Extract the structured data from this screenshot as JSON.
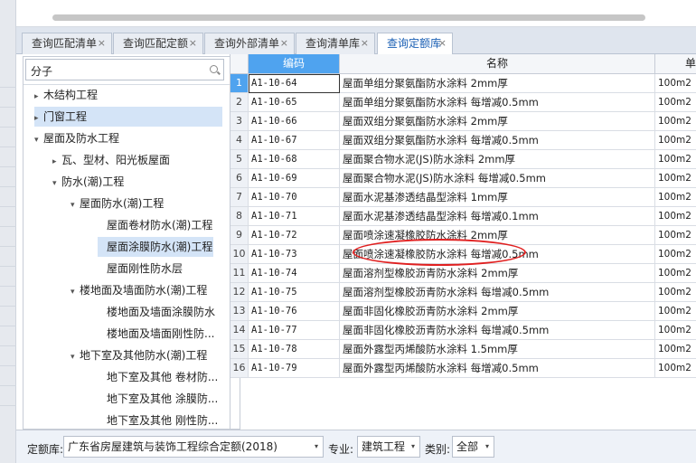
{
  "tabs": [
    {
      "label": "查询匹配清单"
    },
    {
      "label": "查询匹配定额"
    },
    {
      "label": "查询外部清单"
    },
    {
      "label": "查询清单库"
    },
    {
      "label": "查询定额库"
    }
  ],
  "close_glyph": "×",
  "search": {
    "value": "分子",
    "icon": "search-icon"
  },
  "tree": {
    "nodes": [
      {
        "label": "木结构工程",
        "arrow": "▸"
      },
      {
        "label": "门窗工程",
        "arrow": "▸"
      },
      {
        "label": "屋面及防水工程",
        "arrow": "▾"
      },
      {
        "label": "瓦、型材、阳光板屋面",
        "arrow": "▸"
      },
      {
        "label": "防水(潮)工程",
        "arrow": "▾"
      },
      {
        "label": "屋面防水(潮)工程",
        "arrow": "▾"
      },
      {
        "label": "屋面卷材防水(潮)工程",
        "arrow": ""
      },
      {
        "label": "屋面涂膜防水(潮)工程",
        "arrow": ""
      },
      {
        "label": "屋面刚性防水层",
        "arrow": ""
      },
      {
        "label": "楼地面及墙面防水(潮)工程",
        "arrow": "▾"
      },
      {
        "label": "楼地面及墙面涂膜防水",
        "arrow": ""
      },
      {
        "label": "楼地面及墙面刚性防...",
        "arrow": ""
      },
      {
        "label": "地下室及其他防水(潮)工程",
        "arrow": "▾"
      },
      {
        "label": "地下室及其他 卷材防...",
        "arrow": ""
      },
      {
        "label": "地下室及其他 涂膜防...",
        "arrow": ""
      },
      {
        "label": "地下室及其他 刚性防...",
        "arrow": ""
      }
    ]
  },
  "grid": {
    "headers": {
      "code": "编码",
      "name": "名称",
      "unit": "单"
    },
    "rows": [
      {
        "num": "1",
        "code": "A1-10-64",
        "name": "屋面单组分聚氨酯防水涂料 2mm厚",
        "unit": "100m2"
      },
      {
        "num": "2",
        "code": "A1-10-65",
        "name": "屋面单组分聚氨酯防水涂料 每增减0.5mm",
        "unit": "100m2"
      },
      {
        "num": "3",
        "code": "A1-10-66",
        "name": "屋面双组分聚氨酯防水涂料 2mm厚",
        "unit": "100m2"
      },
      {
        "num": "4",
        "code": "A1-10-67",
        "name": "屋面双组分聚氨酯防水涂料 每增减0.5mm",
        "unit": "100m2"
      },
      {
        "num": "5",
        "code": "A1-10-68",
        "name": "屋面聚合物水泥(JS)防水涂料 2mm厚",
        "unit": "100m2"
      },
      {
        "num": "6",
        "code": "A1-10-69",
        "name": "屋面聚合物水泥(JS)防水涂料 每增减0.5mm",
        "unit": "100m2"
      },
      {
        "num": "7",
        "code": "A1-10-70",
        "name": "屋面水泥基渗透结晶型涂料 1mm厚",
        "unit": "100m2"
      },
      {
        "num": "8",
        "code": "A1-10-71",
        "name": "屋面水泥基渗透结晶型涂料 每增减0.1mm",
        "unit": "100m2"
      },
      {
        "num": "9",
        "code": "A1-10-72",
        "name": "屋面喷涂速凝橡胶防水涂料 2mm厚",
        "unit": "100m2"
      },
      {
        "num": "10",
        "code": "A1-10-73",
        "name": "屋面喷涂速凝橡胶防水涂料 每增减0.5mm",
        "unit": "100m2"
      },
      {
        "num": "11",
        "code": "A1-10-74",
        "name": "屋面溶剂型橡胶沥青防水涂料 2mm厚",
        "unit": "100m2"
      },
      {
        "num": "12",
        "code": "A1-10-75",
        "name": "屋面溶剂型橡胶沥青防水涂料 每增减0.5mm",
        "unit": "100m2"
      },
      {
        "num": "13",
        "code": "A1-10-76",
        "name": "屋面非固化橡胶沥青防水涂料 2mm厚",
        "unit": "100m2"
      },
      {
        "num": "14",
        "code": "A1-10-77",
        "name": "屋面非固化橡胶沥青防水涂料 每增减0.5mm",
        "unit": "100m2"
      },
      {
        "num": "15",
        "code": "A1-10-78",
        "name": "屋面外露型丙烯酸防水涂料 1.5mm厚",
        "unit": "100m2"
      },
      {
        "num": "16",
        "code": "A1-10-79",
        "name": "屋面外露型丙烯酸防水涂料 每增减0.5mm",
        "unit": "100m2"
      }
    ]
  },
  "bottom": {
    "quota_label": "定额库:",
    "quota_value": "广东省房屋建筑与装饰工程综合定额(2018)",
    "major_label": "专业:",
    "major_value": "建筑工程",
    "category_label": "类别:",
    "category_value": "全部",
    "dropdown_glyph": "▾"
  },
  "colors": {
    "accent": "#4fa3ef",
    "annotation": "#e02020"
  }
}
